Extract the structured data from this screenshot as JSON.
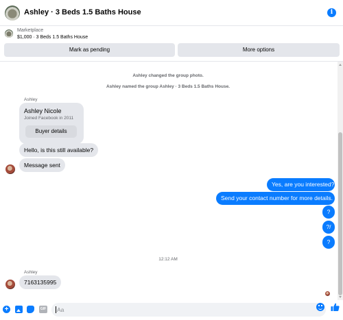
{
  "header": {
    "title": "Ashley · 3 Beds 1.5 Baths House",
    "info_icon": "i"
  },
  "marketplace": {
    "label": "Marketplace",
    "item": "$1,000 · 3 Beds 1.5 Baths House",
    "pending_button": "Mark as pending",
    "more_button": "More options"
  },
  "chat": {
    "system_messages": [
      "Ashley changed the group photo.",
      "Ashley named the group Ashley · 3 Beds 1.5 Baths House."
    ],
    "sender_name_1": "Ashley",
    "profile_card": {
      "name": "Ashley Nicole",
      "joined": "Joined Facebook in 2011",
      "button": "Buyer details"
    },
    "incoming_1": "Hello, is this still available?",
    "incoming_2": "Message sent",
    "outgoing": [
      "Yes, are you interested?",
      "Send your contact number for more details.",
      "?",
      "?/",
      "?"
    ],
    "timestamp": "12:12 AM",
    "sender_name_2": "Ashley",
    "incoming_3": "7163135995"
  },
  "composer": {
    "placeholder": "Aa",
    "plus_icon": "+",
    "gif_label": "GIF"
  },
  "colors": {
    "accent": "#0a7cff",
    "bubble_gray": "#e4e6eb"
  }
}
